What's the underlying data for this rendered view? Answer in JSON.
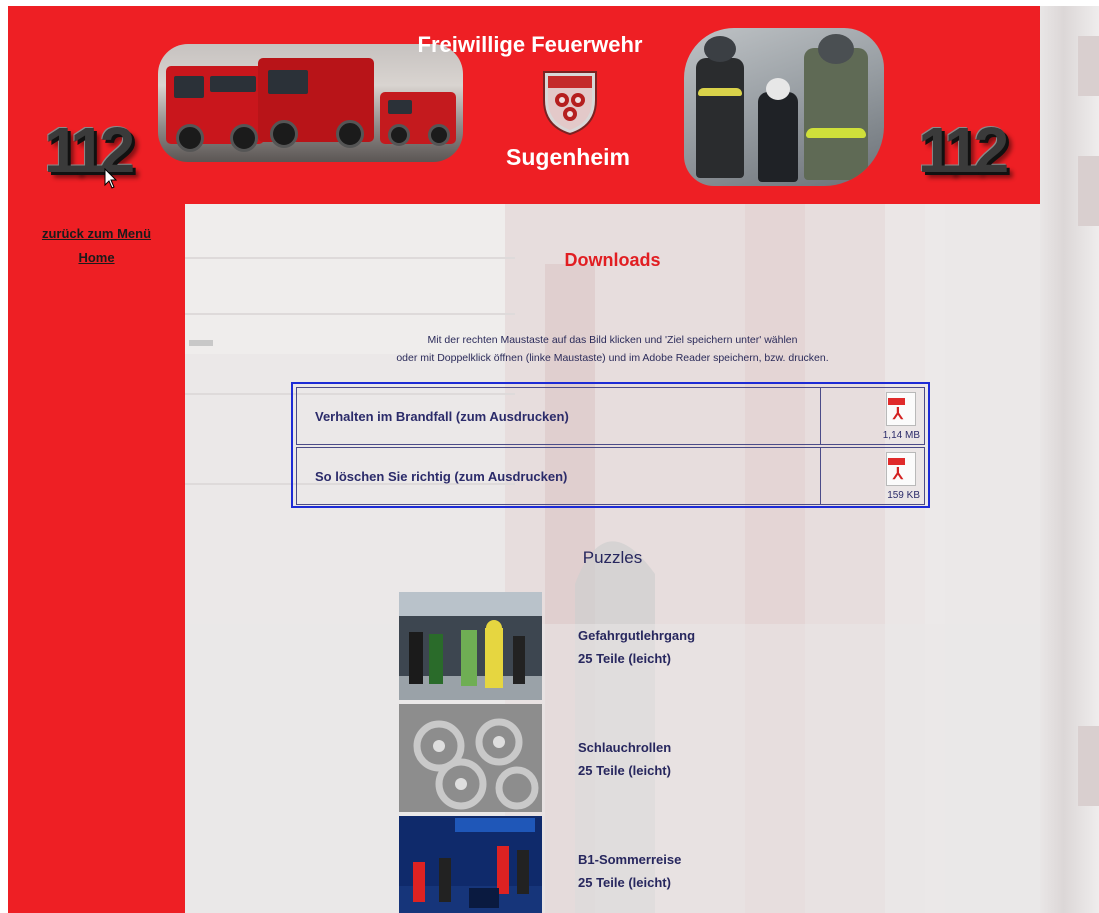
{
  "header": {
    "title_top": "Freiwillige Feuerwehr",
    "title_bottom": "Sugenheim",
    "emergency_number_left": "112",
    "emergency_number_right": "112"
  },
  "nav": {
    "items": [
      {
        "label": "zurück zum Menü"
      },
      {
        "label": "Home"
      }
    ]
  },
  "downloads": {
    "title": "Downloads",
    "instructions": [
      "Mit der rechten Maustaste auf das Bild klicken und 'Ziel speichern unter' wählen",
      "oder mit Doppelklick öffnen (linke Maustaste) und im Adobe Reader speichern, bzw. drucken."
    ],
    "files": [
      {
        "label": "Verhalten im Brandfall (zum Ausdrucken)",
        "size": "1,14 MB",
        "icon": "pdf-icon"
      },
      {
        "label": "So löschen Sie richtig (zum Ausdrucken)",
        "size": "159 KB",
        "icon": "pdf-icon"
      }
    ]
  },
  "puzzles": {
    "title": "Puzzles",
    "items": [
      {
        "name": "Gefahrgutlehrgang",
        "pieces": "25 Teile (leicht)"
      },
      {
        "name": "Schlauchrollen",
        "pieces": "25 Teile (leicht)"
      },
      {
        "name": "B1-Sommerreise",
        "pieces": "25 Teile (leicht)"
      }
    ]
  },
  "colors": {
    "frame_red": "#ee1f24",
    "heading_red": "#e11e22",
    "text_navy": "#27275e",
    "table_border_blue": "#1d2bd6"
  }
}
